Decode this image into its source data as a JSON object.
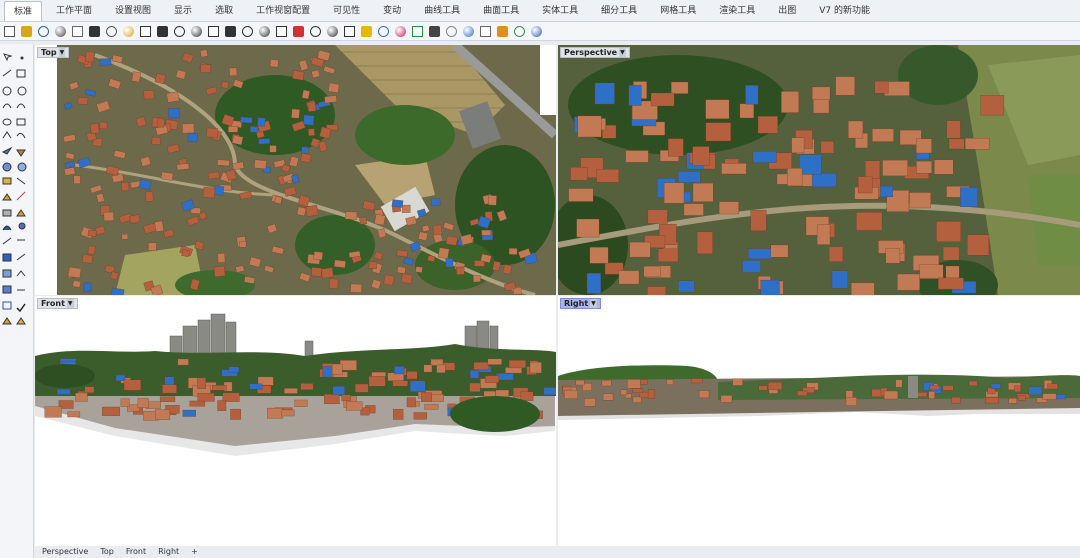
{
  "menu_tabs": [
    "标准",
    "工作平面",
    "设置视图",
    "显示",
    "选取",
    "工作视窗配置",
    "可见性",
    "变动",
    "曲线工具",
    "曲面工具",
    "实体工具",
    "细分工具",
    "网格工具",
    "渲染工具",
    "出图",
    "V7 的新功能"
  ],
  "toolbar_icons": [
    "new-file-icon",
    "open-folder-icon",
    "save-icon",
    "print-icon",
    "import-icon",
    "cut-icon",
    "copy-icon",
    "paste-icon",
    "undo-icon",
    "pan-hand-icon",
    "rotate-view-icon",
    "zoom-icon",
    "zoom-window-icon",
    "zoom-extents-icon",
    "zoom-selected-icon",
    "undo-view-icon",
    "four-viewports-icon",
    "set-cplane-icon",
    "grid-snap-icon",
    "named-views-icon",
    "object-snap-icon",
    "light-icon",
    "layer-icon",
    "properties-icon",
    "render-icon",
    "shaded-sphere-icon",
    "rendered-sphere-icon",
    "globe-icon",
    "settings-gear-icon",
    "curve-tool-icon",
    "earth-icon",
    "help-icon"
  ],
  "viewports": {
    "top": {
      "label": "Top"
    },
    "perspective": {
      "label": "Perspective"
    },
    "front": {
      "label": "Front"
    },
    "right": {
      "label": "Right"
    }
  },
  "viewport_tabs": [
    "Perspective",
    "Top",
    "Front",
    "Right",
    "+"
  ],
  "colors": {
    "active_label": "#a8b6e8",
    "roof_red": "#b4603e",
    "roof_blue": "#2e6fc7",
    "foliage": "#3c6a2c"
  }
}
